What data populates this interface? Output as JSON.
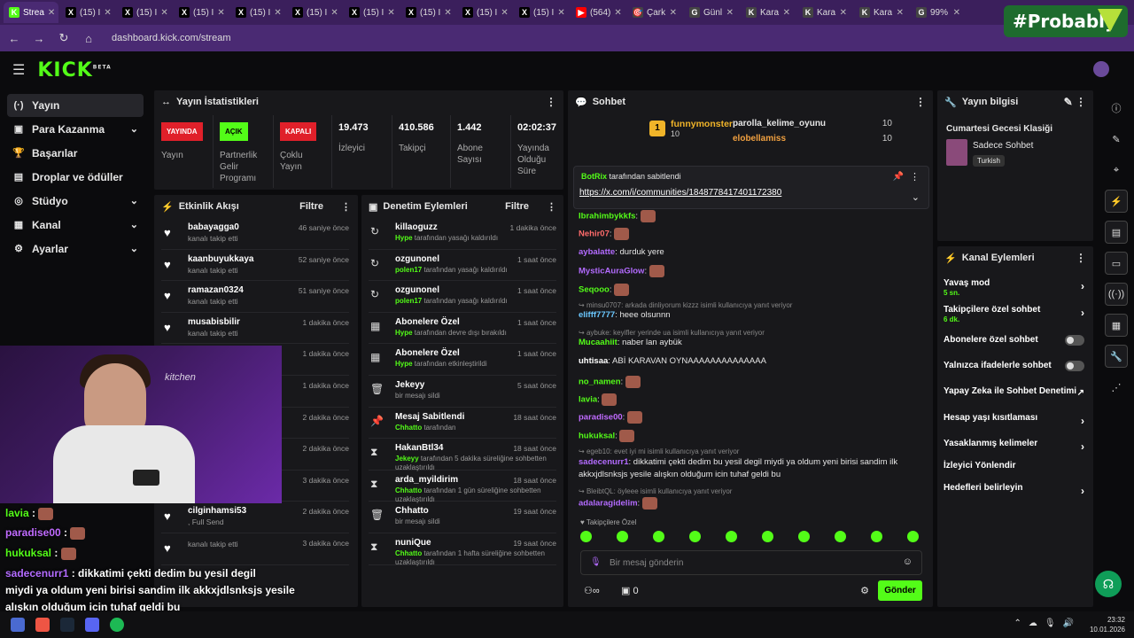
{
  "browser": {
    "tabs": [
      {
        "icon": "K",
        "label": "Strea",
        "color": "#53fc18",
        "active": true
      },
      {
        "icon": "X",
        "label": "(15) I",
        "color": "#000"
      },
      {
        "icon": "X",
        "label": "(15) I",
        "color": "#000"
      },
      {
        "icon": "X",
        "label": "(15) I",
        "color": "#000"
      },
      {
        "icon": "X",
        "label": "(15) I",
        "color": "#000"
      },
      {
        "icon": "X",
        "label": "(15) I",
        "color": "#000"
      },
      {
        "icon": "X",
        "label": "(15) I",
        "color": "#000"
      },
      {
        "icon": "X",
        "label": "(15) I",
        "color": "#000"
      },
      {
        "icon": "X",
        "label": "(15) I",
        "color": "#000"
      },
      {
        "icon": "X",
        "label": "(15) I",
        "color": "#000"
      },
      {
        "icon": "▶",
        "label": "(564)",
        "color": "#ff0000"
      },
      {
        "icon": "🎯",
        "label": "Çark",
        "color": "#444"
      },
      {
        "icon": "G",
        "label": "Günl",
        "color": "#444"
      },
      {
        "icon": "K",
        "label": "Kara",
        "color": "#444"
      },
      {
        "icon": "K",
        "label": "Kara",
        "color": "#444"
      },
      {
        "icon": "K",
        "label": "Kara",
        "color": "#444"
      },
      {
        "icon": "G",
        "label": "99%",
        "color": "#444"
      }
    ],
    "url": "dashboard.kick.com/stream",
    "overlay_text": "#Probably"
  },
  "topbar": {
    "logo": "KICK",
    "logo_badge": "BETA"
  },
  "sidebar": {
    "items": [
      {
        "label": "Yayın",
        "icon": "(·)",
        "active": true
      },
      {
        "label": "Para Kazanma",
        "icon": "▣",
        "chev": true
      },
      {
        "label": "Başarılar",
        "icon": "🏆"
      },
      {
        "label": "Droplar ve ödüller",
        "icon": "▤"
      },
      {
        "label": "Stüdyo",
        "icon": "◎",
        "chev": true
      },
      {
        "label": "Kanal",
        "icon": "▦",
        "chev": true
      },
      {
        "label": "Ayarlar",
        "icon": "⚙",
        "chev": true
      }
    ]
  },
  "stats": {
    "title": "Yayın İstatistikleri",
    "live_badge": "YAYINDA",
    "live_label": "Yayın",
    "partner_badge": "AÇIK",
    "partner_label": "Partnerlik Gelir Programı",
    "multi_badge": "KAPALI",
    "multi_label": "Çoklu Yayın",
    "viewers": "19.473",
    "viewers_label": "İzleyici",
    "followers": "410.586",
    "followers_label": "Takipçi",
    "subs": "1.442",
    "subs_label": "Abone Sayısı",
    "uptime": "02:02:37",
    "uptime_label": "Yayında Olduğu Süre"
  },
  "activity": {
    "title": "Etkinlik Akışı",
    "filter": "Filtre",
    "rows": [
      {
        "name": "babayagga0",
        "sub": "kanalı takip etti",
        "time": "46 saniye önce"
      },
      {
        "name": "kaanbuyukkaya",
        "sub": "kanalı takip etti",
        "time": "52 saniye önce"
      },
      {
        "name": "ramazan0324",
        "sub": "kanalı takip etti",
        "time": "51 saniye önce"
      },
      {
        "name": "musabisbilir",
        "sub": "kanalı takip etti",
        "time": "1 dakika önce"
      },
      {
        "name": "",
        "sub": "",
        "time": "1 dakika önce"
      },
      {
        "name": "",
        "sub": "",
        "time": "1 dakika önce"
      },
      {
        "name": "",
        "sub": "",
        "time": "2 dakika önce"
      },
      {
        "name": "",
        "sub": "",
        "time": "2 dakika önce"
      },
      {
        "name": "kymt26",
        "sub": "kanalı takip etti",
        "time": "3 dakika önce"
      },
      {
        "name": "cilginhamsi53",
        "sub": ", Full Send",
        "time": "2 dakika önce"
      },
      {
        "name": "",
        "sub": "kanalı takip etti",
        "time": "3 dakika önce"
      }
    ]
  },
  "moderation": {
    "title": "Denetim Eylemleri",
    "filter": "Filtre",
    "rows": [
      {
        "icon": "↻",
        "name": "killaoguzz",
        "who": "Hype",
        "rest": " tarafından yasağı kaldırıldı",
        "time": "1 dakika önce"
      },
      {
        "icon": "↻",
        "name": "ozgunonel",
        "who": "polen17",
        "rest": " tarafından yasağı kaldırıldı",
        "time": "1 saat önce"
      },
      {
        "icon": "↻",
        "name": "ozgunonel",
        "who": "polen17",
        "rest": " tarafından yasağı kaldırıldı",
        "time": "1 saat önce"
      },
      {
        "icon": "▦",
        "name": "Abonelere Özel",
        "who": "Hype",
        "rest": " tarafından devre dışı bırakıldı",
        "time": "1 saat önce"
      },
      {
        "icon": "▦",
        "name": "Abonelere Özel",
        "who": "Hype",
        "rest": " tarafından etkinleştirildi",
        "time": "1 saat önce"
      },
      {
        "icon": "🗑",
        "name": "Jekeyy",
        "who": "",
        "rest": "bir mesajı sildi",
        "time": "5 saat önce"
      },
      {
        "icon": "📌",
        "name": "Mesaj Sabitlendi",
        "who": "Chhatto",
        "rest": " tarafından",
        "time": "18 saat önce"
      },
      {
        "icon": "⧗",
        "name": "HakanBtl34",
        "who": "Jekeyy",
        "rest": " tarafından 5 dakika süreliğine sohbetten uzaklaştırıldı",
        "time": "18 saat önce"
      },
      {
        "icon": "⧗",
        "name": "arda_myildirim",
        "who": "Chhatto",
        "rest": " tarafından 1 gün süreliğine sohbetten uzaklaştırıldı",
        "time": "18 saat önce"
      },
      {
        "icon": "🗑",
        "name": "Chhatto",
        "who": "",
        "rest": "bir mesajı sildi",
        "time": "19 saat önce"
      },
      {
        "icon": "⧗",
        "name": "nuniQue",
        "who": "Chhatto",
        "rest": " tarafından 1 hafta süreliğine sohbetten uzaklaştırıldı",
        "time": "19 saat önce"
      }
    ]
  },
  "chat": {
    "title": "Sohbet",
    "leaderboard": [
      {
        "rank": "1",
        "name": "funnymonster",
        "count": "10"
      },
      {
        "name": "parolla_kelime_oyunu",
        "count": "10"
      },
      {
        "name": "elobellamiss",
        "count": "10"
      }
    ],
    "pinned_by": "BotRix",
    "pinned_suffix": "tarafından sabitlendi",
    "pinned_link": "https://x.com/i/communities/1848778417401172380",
    "messages": [
      {
        "user": "Ibrahimbykkfs",
        "color": "#53fc18",
        "text": ""
      },
      {
        "user": "Nehir07",
        "color": "#ff6b6b",
        "text": ""
      },
      {
        "user": "aybalatte",
        "color": "#b36bff",
        "text": " durduk yere"
      },
      {
        "user": "MysticAuraGlow",
        "color": "#b36bff",
        "text": ""
      },
      {
        "user": "Seqooo",
        "color": "#53fc18",
        "text": ""
      },
      {
        "user": "elifff7777",
        "color": "#6bc8ff",
        "text": " heee olsunnn"
      },
      {
        "user": "Mucaahiit",
        "color": "#53fc18",
        "text": " naber lan aybük"
      },
      {
        "user": "uhtisaa",
        "color": "#ffffff",
        "text": " ABİ KARAVAN OYNAAAAAAAAAAAAAA"
      },
      {
        "user": "no_namen",
        "color": "#53fc18",
        "text": ""
      },
      {
        "user": "lavia",
        "color": "#53fc18",
        "text": ""
      },
      {
        "user": "paradise00",
        "color": "#c06bff",
        "text": ""
      },
      {
        "user": "hukuksal",
        "color": "#53fc18",
        "text": ""
      },
      {
        "user": "sadecenurr1",
        "color": "#b36bff",
        "text": " dikkatimi çekti dedim bu yesil degil miydi ya oldum yeni birisi sandim ilk"
      },
      {
        "user": "",
        "color": "#fff",
        "text": "akkxjdlsnksjs yesile alışkın olduğum icin tuhaf geldi bu"
      },
      {
        "user": "adalaragidelim",
        "color": "#b36bff",
        "text": ""
      }
    ],
    "replies": [
      "minsu0707: arkada dinliyorum kizzz isimli kullanıcıya yanıt veriyor",
      "aybuke: keyifler yerinde ua isimli kullanıcıya yanıt veriyor",
      "egeb10: evet iyi mi isimli kullanıcıya yanıt veriyor",
      "BleibtQL: öyleee isimli kullanıcıya yanıt veriyor"
    ],
    "emote_label": "Takipçilere Özel",
    "input_placeholder": "Bir mesaj gönderin",
    "count": "0",
    "send_label": "Gönder"
  },
  "info": {
    "title": "Yayın bilgisi",
    "stream_title": "Cumartesi Gecesi Klasiği",
    "category": "Sadece Sohbet",
    "language": "Turkish"
  },
  "actions": {
    "title": "Kanal Eylemleri",
    "items": [
      {
        "label": "Yavaş mod",
        "small": "5 sn.",
        "kind": "chev"
      },
      {
        "label": "Takipçilere özel sohbet",
        "small": "6 dk.",
        "kind": "chev"
      },
      {
        "label": "Abonelere özel sohbet",
        "small": "",
        "kind": "toggle"
      },
      {
        "label": "Yalnızca ifadelerle sohbet",
        "small": "",
        "kind": "toggle"
      },
      {
        "label": "Yapay Zeka ile Sohbet Denetimi",
        "small": "",
        "kind": "ext"
      },
      {
        "label": "Hesap yaşı kısıtlaması",
        "small": "",
        "kind": "chev"
      },
      {
        "label": "Yasaklanmış kelimeler",
        "small": "",
        "kind": "chev"
      },
      {
        "label": "İzleyici Yönlendir",
        "small": "",
        "kind": "none"
      },
      {
        "label": "Hedefleri belirleyin",
        "small": "",
        "kind": "chev"
      }
    ]
  },
  "overlay": {
    "lines": [
      {
        "user": "lavia",
        "color": "#53fc18",
        "text": ""
      },
      {
        "user": "paradise00",
        "color": "#c06bff",
        "text": ""
      },
      {
        "user": "hukuksal",
        "color": "#53fc18",
        "text": ""
      },
      {
        "user": "sadecenurr1",
        "color": "#b36bff",
        "text": " dikkatimi çekti dedim bu yesil degil"
      },
      {
        "user": "",
        "color": "#fff",
        "text": "miydi ya oldum yeni birisi sandim ilk akkxjdlsnksjs yesile"
      },
      {
        "user": "",
        "color": "#fff",
        "text": "alışkın olduğum icin tuhaf geldi bu"
      },
      {
        "user": "adalaragidelim",
        "color": "#b36bff",
        "text": ""
      }
    ],
    "neon": "kitchen"
  },
  "taskbar": {
    "time": "23:32",
    "date": "10.01.2026"
  }
}
